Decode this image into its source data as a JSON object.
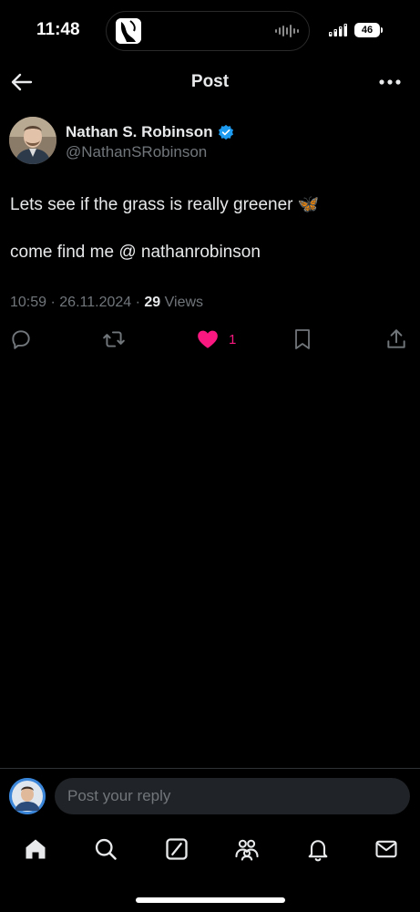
{
  "status_bar": {
    "time": "11:48",
    "battery": "46"
  },
  "header": {
    "title": "Post",
    "back_icon": "arrow-left-icon",
    "more_icon": "more-horizontal-icon"
  },
  "post": {
    "author_name": "Nathan S. Robinson",
    "handle": "@NathanSRobinson",
    "verified": true,
    "lines": [
      "Lets see if the grass is really greener 🦋",
      "come find me @ nathanrobinson"
    ],
    "time": "10:59",
    "date": "26.11.2024",
    "views_count": "29",
    "views_label": "Views",
    "actions": {
      "reply_icon": "reply-icon",
      "retweet_icon": "retweet-icon",
      "like_icon": "heart-icon",
      "like_count": "1",
      "bookmark_icon": "bookmark-icon",
      "share_icon": "share-icon"
    }
  },
  "reply_bar": {
    "placeholder": "Post your reply"
  },
  "tabbar": {
    "items": [
      "home-icon",
      "search-icon",
      "grok-icon",
      "communities-icon",
      "notifications-icon",
      "messages-icon"
    ]
  },
  "colors": {
    "background": "#000000",
    "text": "#e7e9ea",
    "secondary": "#71767b",
    "like": "#f91880",
    "verified": "#1d9bf0"
  }
}
